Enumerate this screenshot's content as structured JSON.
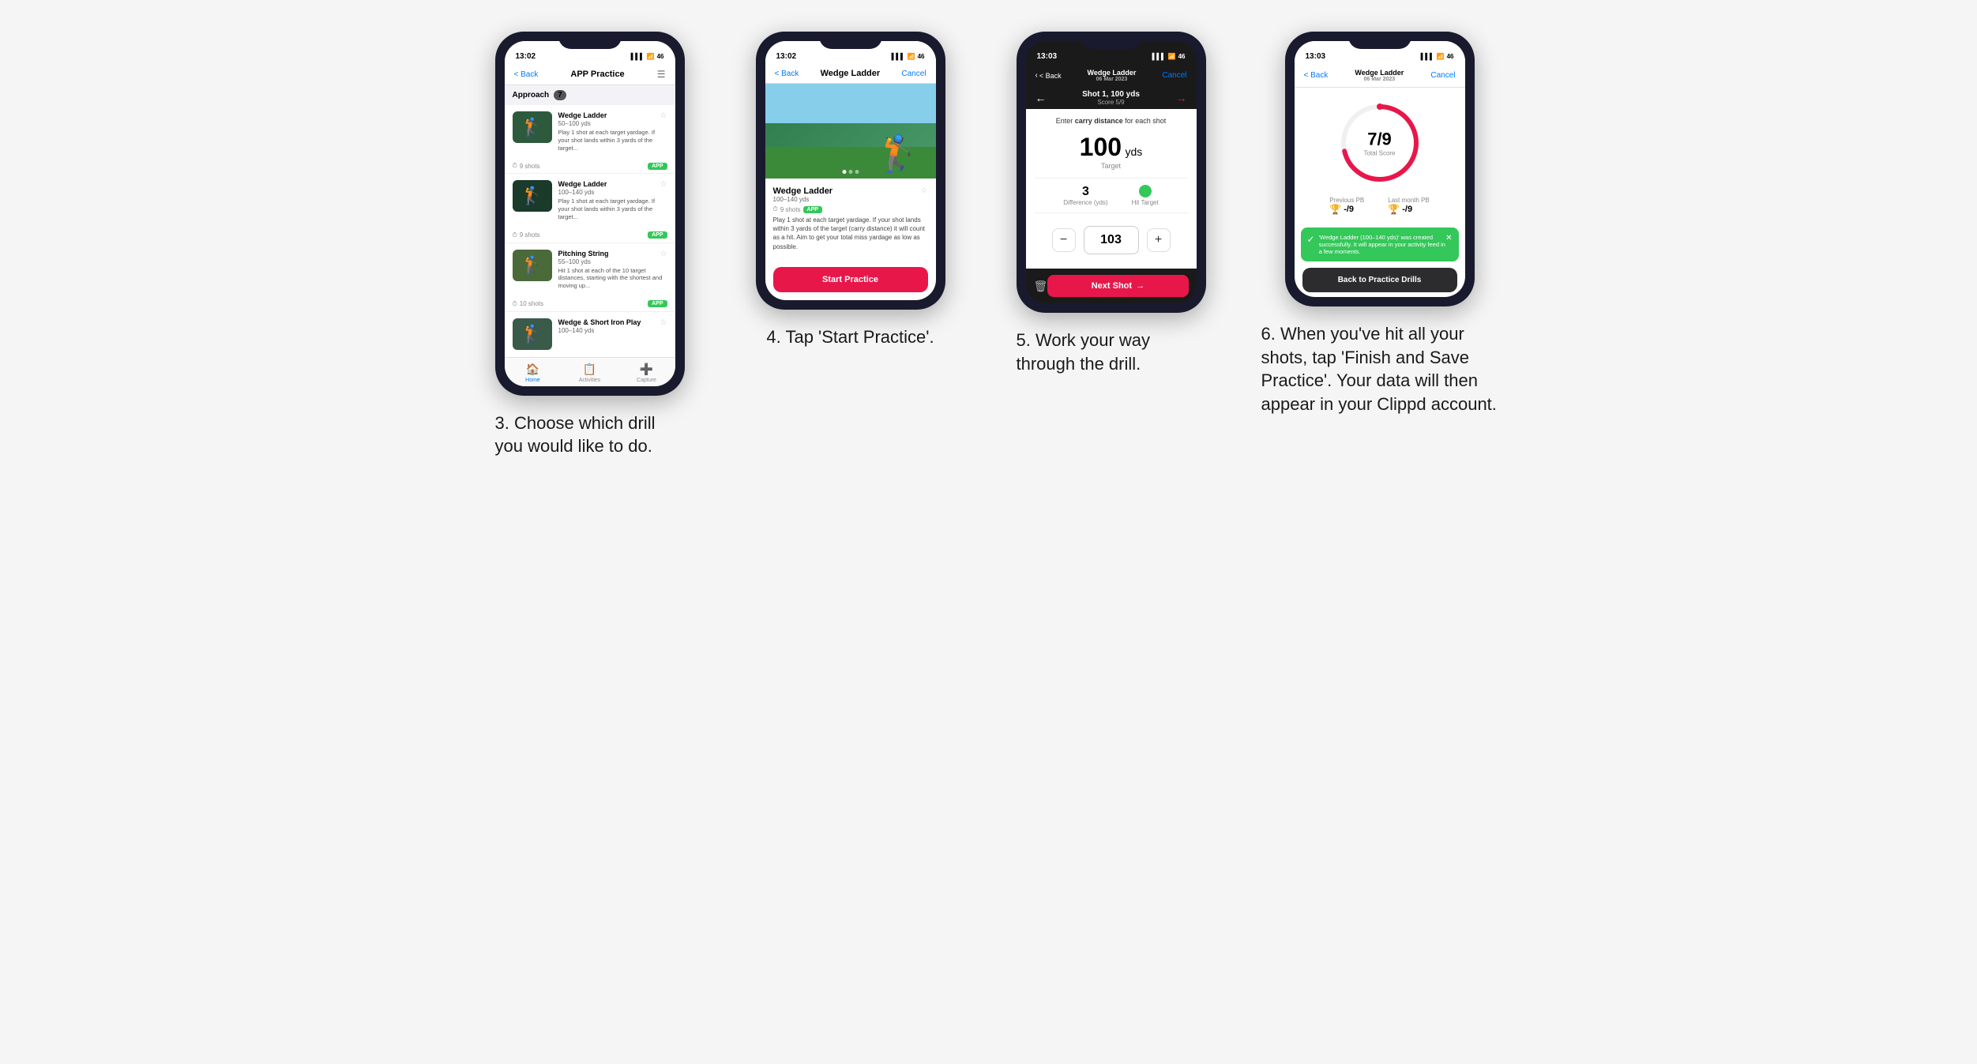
{
  "phones": [
    {
      "id": "phone1",
      "statusBar": {
        "time": "13:02",
        "signal": "▌▌▌",
        "wifi": "WiFi",
        "battery": "46"
      },
      "nav": {
        "back": "< Back",
        "title": "APP Practice",
        "action": "☰"
      },
      "sectionTag": "Approach",
      "sectionCount": "7",
      "drills": [
        {
          "name": "Wedge Ladder",
          "yds": "50–100 yds",
          "desc": "Play 1 shot at each target yardage. If your shot lands within 3 yards of the target...",
          "shots": "9 shots",
          "badge": "APP",
          "img": "img1"
        },
        {
          "name": "Wedge Ladder",
          "yds": "100–140 yds",
          "desc": "Play 1 shot at each target yardage. If your shot lands within 3 yards of the target...",
          "shots": "9 shots",
          "badge": "APP",
          "img": "img2"
        },
        {
          "name": "Pitching String",
          "yds": "55–100 yds",
          "desc": "Hit 1 shot at each of the 10 target distances, starting with the shortest and moving up...",
          "shots": "10 shots",
          "badge": "APP",
          "img": "img3"
        },
        {
          "name": "Wedge & Short Iron Play",
          "yds": "100–140 yds",
          "desc": "",
          "shots": "",
          "badge": "",
          "img": "img4"
        }
      ],
      "tabs": [
        "Home",
        "Activities",
        "Capture"
      ]
    },
    {
      "id": "phone2",
      "statusBar": {
        "time": "13:02",
        "signal": "▌▌▌",
        "wifi": "WiFi",
        "battery": "46"
      },
      "nav": {
        "back": "< Back",
        "title": "Wedge Ladder",
        "action": "Cancel"
      },
      "drillTitle": "Wedge Ladder",
      "drillYds": "100–140 yds",
      "drillShots": "9 shots",
      "drillBadge": "APP",
      "drillDesc": "Play 1 shot at each target yardage. If your shot lands within 3 yards of the target (carry distance) it will count as a hit. Aim to get your total miss yardage as low as possible.",
      "startBtn": "Start Practice"
    },
    {
      "id": "phone3",
      "statusBar": {
        "time": "13:03",
        "signal": "▌▌▌",
        "wifi": "WiFi",
        "battery": "46"
      },
      "nav": {
        "back": "< Back",
        "titleTop": "Wedge Ladder",
        "titleBot": "06 Mar 2023",
        "action": "Cancel"
      },
      "shotLabel": "Shot 1, 100 yds",
      "scoreLabel": "Score 5/9",
      "instruction": "Enter carry distance for each shot",
      "targetYds": "100",
      "targetUnit": "yds",
      "targetLabel": "Target",
      "difference": "3",
      "differenceLabel": "Difference (yds)",
      "hitTarget": "Hit Target",
      "inputValue": "103",
      "nextShot": "Next Shot"
    },
    {
      "id": "phone4",
      "statusBar": {
        "time": "13:03",
        "signal": "▌▌▌",
        "wifi": "WiFi",
        "battery": "46"
      },
      "nav": {
        "back": "< Back",
        "titleTop": "Wedge Ladder",
        "titleBot": "06 Mar 2023",
        "action": "Cancel"
      },
      "totalScore": "7/9",
      "totalScoreLabel": "Total Score",
      "previousPBLabel": "Previous PB",
      "previousPBVal": "-/9",
      "lastMonthPBLabel": "Last month PB",
      "lastMonthPBVal": "-/9",
      "toastText": "'Wedge Ladder (100–140 yds)' was created successfully. It will appear in your activity feed in a few moments.",
      "backBtn": "Back to Practice Drills"
    }
  ],
  "captions": [
    "3. Choose which drill you would like to do.",
    "4. Tap 'Start Practice'.",
    "5. Work your way through the drill.",
    "6. When you've hit all your shots, tap 'Finish and Save Practice'. Your data will then appear in your Clippd account."
  ]
}
